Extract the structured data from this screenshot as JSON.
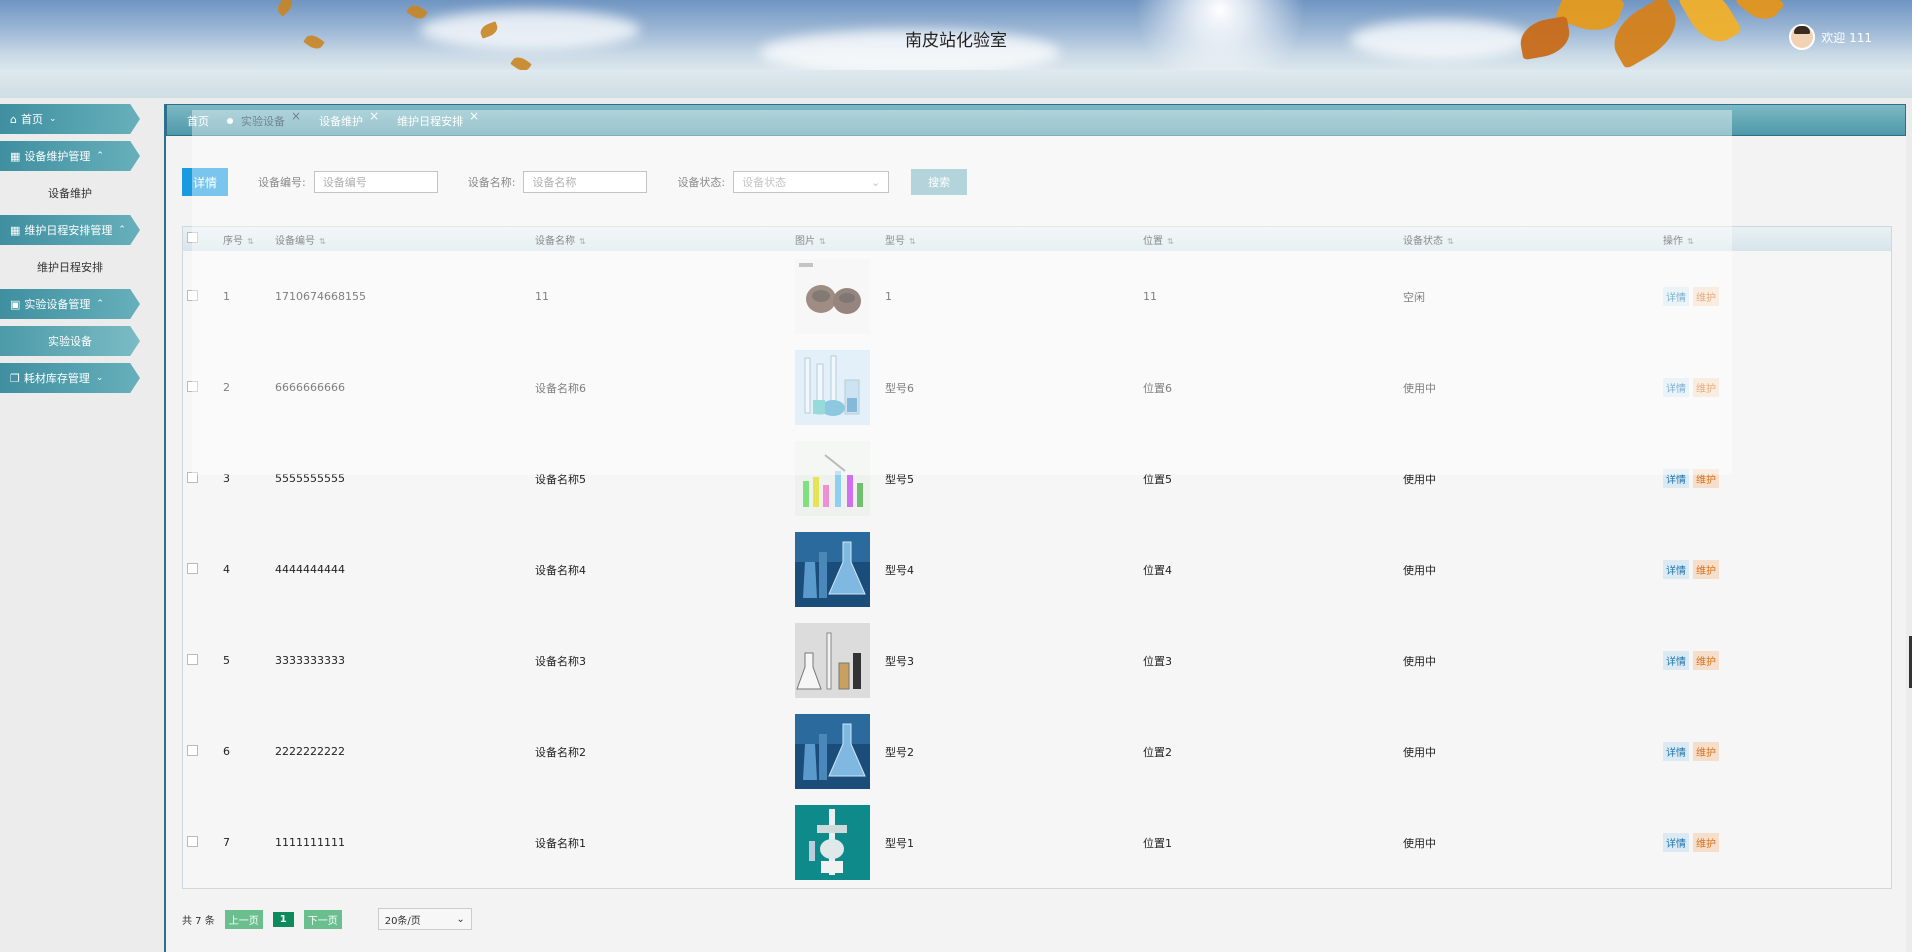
{
  "header": {
    "title": "南皮站化验室",
    "welcome": "欢迎 111"
  },
  "sidebar": {
    "items": [
      {
        "label": "首页",
        "type": "head",
        "chevron": "down"
      },
      {
        "label": "设备维护管理",
        "type": "head",
        "chevron": "up"
      },
      {
        "label": "设备维护",
        "type": "sub"
      },
      {
        "label": "维护日程安排管理",
        "type": "head",
        "chevron": "up"
      },
      {
        "label": "维护日程安排",
        "type": "sub"
      },
      {
        "label": "实验设备管理",
        "type": "head",
        "chevron": "up"
      },
      {
        "label": "实验设备",
        "type": "sub",
        "active": true
      },
      {
        "label": "耗材库存管理",
        "type": "head",
        "chevron": "down"
      }
    ]
  },
  "tabs": [
    {
      "label": "首页",
      "closable": false
    },
    {
      "label": "实验设备",
      "closable": true,
      "active": true
    },
    {
      "label": "设备维护",
      "closable": true
    },
    {
      "label": "维护日程安排",
      "closable": true
    }
  ],
  "toolbar": {
    "detail_label": "详情",
    "code_label": "设备编号:",
    "code_placeholder": "设备编号",
    "name_label": "设备名称:",
    "name_placeholder": "设备名称",
    "status_label": "设备状态:",
    "status_placeholder": "设备状态",
    "search_label": "搜索"
  },
  "table": {
    "columns": [
      "序号",
      "设备编号",
      "设备名称",
      "图片",
      "型号",
      "位置",
      "设备状态",
      "操作"
    ],
    "rows": [
      {
        "seq": "1",
        "code": "1710674668155",
        "name": "11",
        "model": "1",
        "location": "11",
        "status": "空闲",
        "img": "caps"
      },
      {
        "seq": "2",
        "code": "6666666666",
        "name": "设备名称6",
        "model": "型号6",
        "location": "位置6",
        "status": "使用中",
        "img": "tubes"
      },
      {
        "seq": "3",
        "code": "5555555555",
        "name": "设备名称5",
        "model": "型号5",
        "location": "位置5",
        "status": "使用中",
        "img": "colored"
      },
      {
        "seq": "4",
        "code": "4444444444",
        "name": "设备名称4",
        "model": "型号4",
        "location": "位置4",
        "status": "使用中",
        "img": "flask-blue"
      },
      {
        "seq": "5",
        "code": "3333333333",
        "name": "设备名称3",
        "model": "型号3",
        "location": "位置3",
        "status": "使用中",
        "img": "glassware"
      },
      {
        "seq": "6",
        "code": "2222222222",
        "name": "设备名称2",
        "model": "型号2",
        "location": "位置2",
        "status": "使用中",
        "img": "flask-blue"
      },
      {
        "seq": "7",
        "code": "1111111111",
        "name": "设备名称1",
        "model": "型号1",
        "location": "位置1",
        "status": "使用中",
        "img": "apparatus"
      }
    ],
    "detail_btn": "详情",
    "maintain_btn": "维护"
  },
  "pager": {
    "total": "共 7 条",
    "prev": "上一页",
    "page": "1",
    "next": "下一页",
    "size": "20条/页"
  },
  "colors": {
    "accent": "#1a9be0",
    "teal": "#4f99a8",
    "maintain": "#d8731c"
  }
}
